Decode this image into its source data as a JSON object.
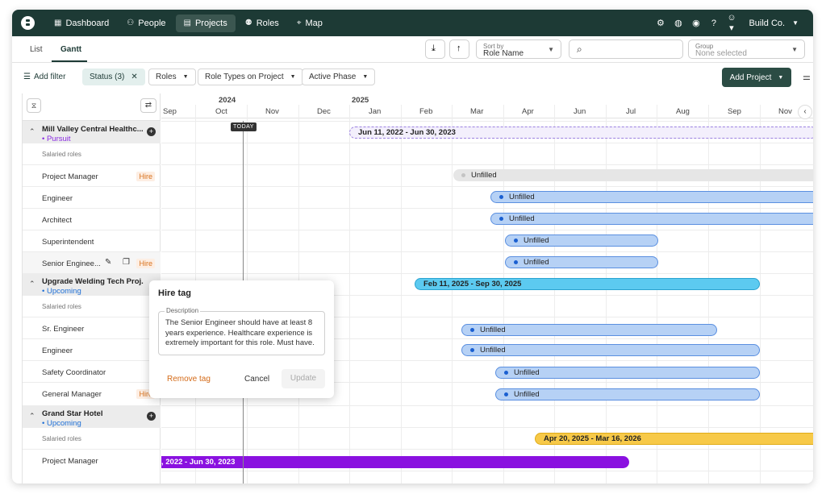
{
  "nav": {
    "items": [
      {
        "label": "Dashboard",
        "icon": "grid-icon"
      },
      {
        "label": "People",
        "icon": "people-icon"
      },
      {
        "label": "Projects",
        "icon": "projects-icon"
      },
      {
        "label": "Roles",
        "icon": "roles-icon"
      },
      {
        "label": "Map",
        "icon": "map-pin-icon"
      }
    ],
    "active": "Projects",
    "company": "Build Co."
  },
  "tabs": {
    "list": "List",
    "gantt": "Gantt",
    "active": "Gantt"
  },
  "toolbar": {
    "sort_label": "Sort by",
    "sort_value": "Role Name",
    "search_placeholder": "",
    "group_label": "Group",
    "group_value": "None selected"
  },
  "filters": {
    "add_filter": "Add filter",
    "status": "Status (3)",
    "roles": "Roles",
    "role_types": "Role Types on Project",
    "active_phase": "Active Phase",
    "add_project": "Add Project"
  },
  "timeline": {
    "year_2024": "2024",
    "year_2025": "2025",
    "months": [
      "Sep",
      "Oct",
      "Nov",
      "Dec",
      "Jan",
      "Feb",
      "Mar",
      "Apr",
      "Jun",
      "Jul",
      "Aug",
      "Sep",
      "Nov"
    ],
    "today": "TODAY"
  },
  "projects": [
    {
      "name": "Mill Valley Central Healthc...",
      "status": "Pursuit",
      "status_color": "#8a2be2",
      "salaried": "Salaried roles",
      "roles": [
        "Project Manager",
        "Engineer",
        "Architect",
        "Superintendent",
        "Senior Enginee..."
      ],
      "date_range": "Jun 11, 2022 - Jun 30, 2023"
    },
    {
      "name": "Upgrade Welding Tech Proj...",
      "status": "Upcoming",
      "status_color": "#1e6fd6",
      "salaried": "Salaried roles",
      "roles": [
        "Sr. Engineer",
        "Engineer",
        "Safety Coordinator",
        "General Manager"
      ],
      "date_range": "Feb 11, 2025 - Sep 30, 2025"
    },
    {
      "name": "Grand Star Hotel",
      "status": "Upcoming",
      "status_color": "#1e6fd6",
      "salaried": "Salaried roles",
      "roles": [
        "Project Manager"
      ],
      "date_range": "Apr 20, 2025 - Mar 16, 2026",
      "pm_bar": ", 2022 - Jun 30, 2023"
    }
  ],
  "hire_tag": "Hire",
  "unfilled": "Unfilled",
  "popup": {
    "title": "Hire tag",
    "desc_label": "Description",
    "desc_text": "The Senior Engineer should have at least 8 years experience. Healthcare experience is extremely important for this role. Must have.",
    "remove": "Remove tag",
    "cancel": "Cancel",
    "update": "Update"
  },
  "colors": {
    "nav_bg": "#1d3a35",
    "pursuit": "#8a2be2",
    "upcoming": "#1e6fd6",
    "hire": "#d8711b",
    "project_bar_cyan": "#5ccaf0",
    "project_bar_yellow": "#f7c948",
    "project_bar_purple": "#8a11e0"
  }
}
